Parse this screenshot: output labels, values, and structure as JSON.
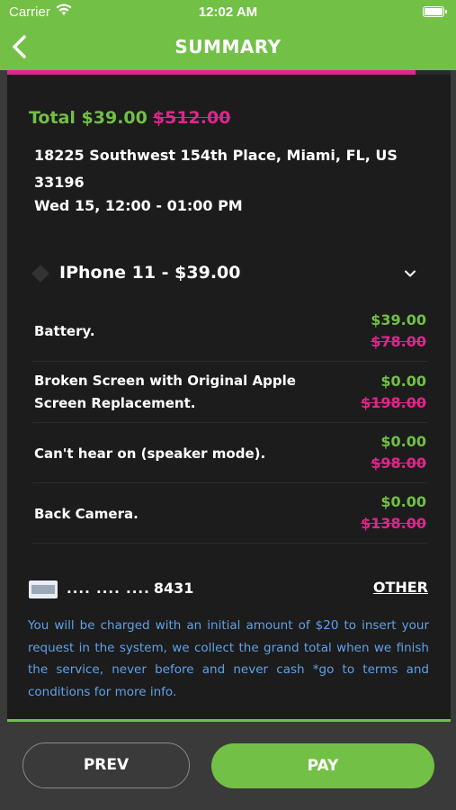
{
  "status_bar": {
    "carrier": "Carrier",
    "time": "12:02 AM",
    "wifi_icon": "wifi-icon",
    "battery_icon": "battery-icon"
  },
  "header": {
    "title": "SUMMARY",
    "back_icon": "chevron-left-icon",
    "bar_color": "#72c045"
  },
  "progress": {
    "value": 0.92,
    "color": "#e0258b"
  },
  "summary": {
    "total_label": "Total",
    "total_price": "$39.00",
    "total_original": "$512.00",
    "address": "18225 Southwest 154th Place,  Miami, FL, US 33196",
    "datetime": "Wed 15, 12:00 - 01:00 PM"
  },
  "device": {
    "label": "IPhone 11 - $39.00",
    "expand_icon": "chevron-down-icon"
  },
  "items": [
    {
      "name": "Battery.",
      "price": "$39.00",
      "original": "$78.00"
    },
    {
      "name": "Broken Screen with Original Apple Screen Replacement.",
      "price": "$0.00",
      "original": "$198.00"
    },
    {
      "name": "Can't hear on (speaker mode).",
      "price": "$0.00",
      "original": "$98.00"
    },
    {
      "name": "Back Camera.",
      "price": "$0.00",
      "original": "$138.00"
    }
  ],
  "payment": {
    "card_icon": "amex-card-icon",
    "mask": ".... .... ....",
    "last4": "8431",
    "other_label": "OTHER"
  },
  "note": "You will be charged with an initial amount of $20 to insert your request in the system, we collect the grand total when we finish the service, never before and never cash *go to terms and conditions for more info.",
  "buttons": {
    "prev": "PREV",
    "pay": "PAY"
  },
  "colors": {
    "accent_green": "#72c045",
    "accent_pink": "#e0258b",
    "note_blue": "#5fa1e8",
    "card_bg": "#1c1c1c",
    "page_bg": "#3a3a3a"
  }
}
